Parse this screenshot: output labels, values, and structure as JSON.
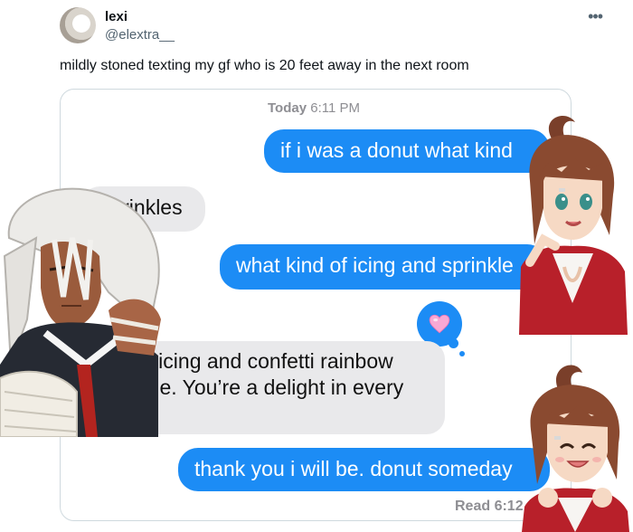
{
  "tweet": {
    "author_name": "lexi",
    "author_handle": "@elextra__",
    "more_icon": "more-dots-icon",
    "more_glyph": "•••",
    "text": "mildly stoned texting my gf who is 20 feet away in the next room"
  },
  "conversation": {
    "timestamp_day": "Today",
    "timestamp_time": "6:11 PM",
    "messages": [
      {
        "direction": "sent",
        "text": "if i was a donut what kind"
      },
      {
        "direction": "received",
        "text": "Sprinkles"
      },
      {
        "direction": "sent",
        "text": "what kind of icing and sprinkle"
      },
      {
        "direction": "received",
        "text": "White icing and confetti rainbow sprinkle. You’re a delight in every way"
      },
      {
        "direction": "sent",
        "text": "thank you i will be. donut someday"
      }
    ],
    "tapback_icon": "pink-heart-icon",
    "read_receipt": "Read 6:12"
  },
  "stickers": [
    "white-haired-character-sticker",
    "brunette-character-sticker-pointing",
    "brunette-character-sticker-smiling"
  ],
  "colors": {
    "sent_bubble": "#1c8cf5",
    "received_bubble": "#e9e9eb",
    "heart": "#f9a8d4"
  }
}
